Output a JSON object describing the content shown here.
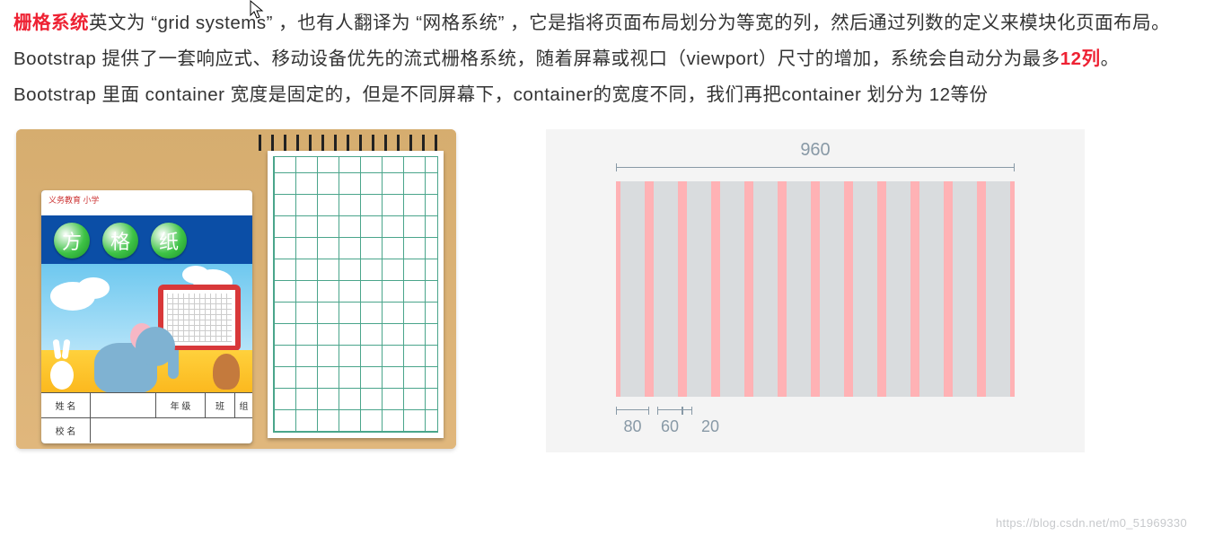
{
  "text": {
    "p1_a": "栅格系统",
    "p1_b": "英文为 “grid systems” ，也有人翻译为 “网格系统” ，它是指将页面布局划分为等宽的列，然后通过列数的定义来模块化页面布局。",
    "p2_a": "Bootstrap 提供了一套响应式、移动设备优先的流式栅格系统，随着屏幕或视口（viewport）尺寸的增加，系统会自动分为最多",
    "p2_b": "12列",
    "p2_c": "。",
    "p3": " Bootstrap 里面 container 宽度是固定的，但是不同屏幕下，container的宽度不同，我们再把container 划分为 12等份"
  },
  "notebook": {
    "top_label": "义务教育  小学",
    "title_chars": [
      "方",
      "格",
      "纸"
    ],
    "form_row1": [
      "姓  名",
      "年  级",
      "班",
      "组"
    ],
    "form_row2": [
      "校  名"
    ]
  },
  "diagram": {
    "total_width": "960",
    "col_width": "60",
    "gutter_width": "20",
    "unit_width": "80"
  },
  "watermark": "https://blog.csdn.net/m0_51969330"
}
